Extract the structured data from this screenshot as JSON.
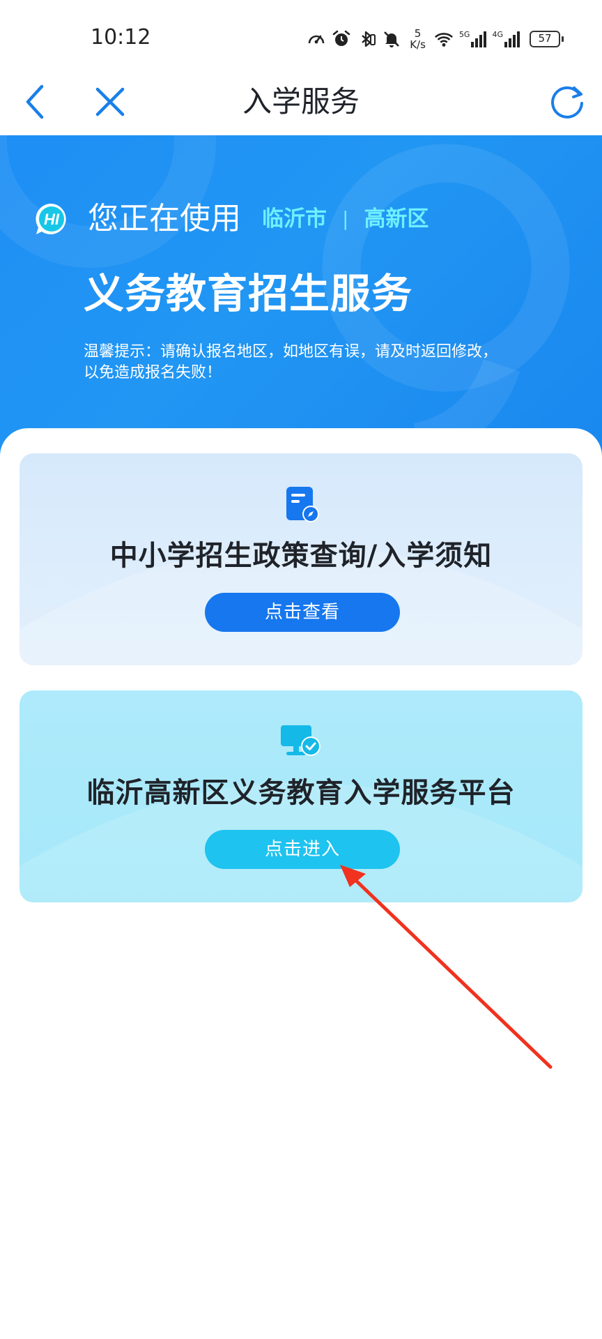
{
  "status_bar": {
    "time": "10:12",
    "speed_value": "5",
    "speed_unit": "K/s",
    "network_1": "5G",
    "network_2": "4G",
    "battery": "57",
    "icons": [
      "data-saver-icon",
      "alarm-icon",
      "bluetooth-icon",
      "mute-icon",
      "wifi-icon",
      "signal-icon"
    ]
  },
  "navbar": {
    "title": "入学服务",
    "back_icon": "chevron-left-icon",
    "close_icon": "close-icon",
    "refresh_icon": "refresh-icon"
  },
  "hero": {
    "logo_text": "HI",
    "using_label": "您正在使用",
    "city": "临沂市",
    "separator": "|",
    "district": "高新区",
    "title": "义务教育招生服务",
    "tip": "温馨提示：请确认报名地区，如地区有误，请及时返回修改，以免造成报名失败！"
  },
  "cards": [
    {
      "icon": "document-compass-icon",
      "title": "中小学招生政策查询/入学须知",
      "button_label": "点击查看"
    },
    {
      "icon": "monitor-check-icon",
      "title": "临沂高新区义务教育入学服务平台",
      "button_label": "点击进入"
    }
  ],
  "colors": {
    "hero_blue": "#2196f3",
    "accent_cyan": "#6ff0ff",
    "button_blue": "#1677ee",
    "button_cyan": "#1ec3ef",
    "annotation_red": "#f0321e"
  }
}
